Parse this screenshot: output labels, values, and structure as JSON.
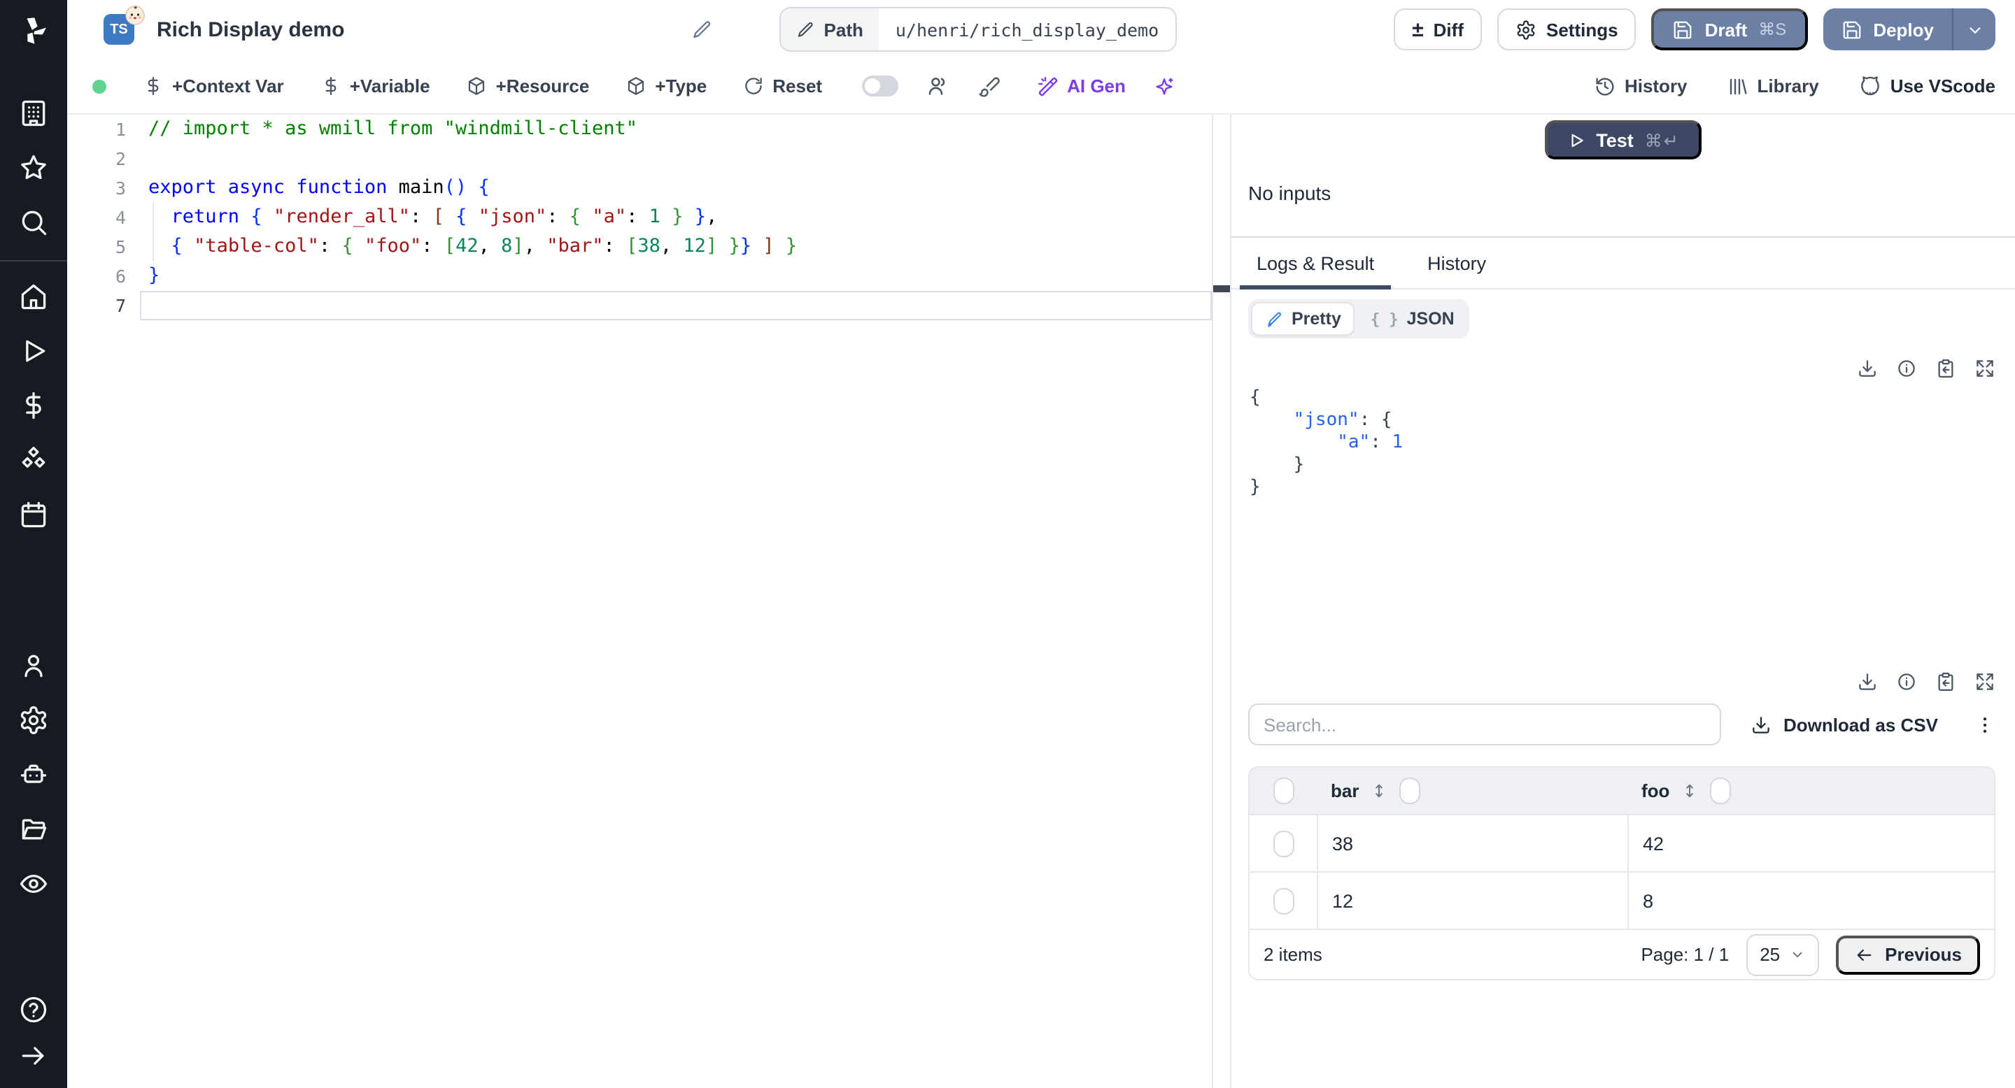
{
  "app": {
    "name": "Windmill"
  },
  "header": {
    "language_badge": "TS",
    "title": "Rich Display demo",
    "path_label": "Path",
    "path_value": "u/henri/rich_display_demo",
    "diff_label": "Diff",
    "settings_label": "Settings",
    "draft_label": "Draft",
    "draft_shortcut": "⌘S",
    "deploy_label": "Deploy"
  },
  "toolbar": {
    "status_dot_color": "#5fd38f",
    "context_var_label": "+Context Var",
    "variable_label": "+Variable",
    "resource_label": "+Resource",
    "type_label": "+Type",
    "reset_label": "Reset",
    "ai_gen_label": "AI Gen",
    "ai_accent_color": "#7c3aed",
    "history_label": "History",
    "library_label": "Library",
    "vscode_label": "Use VScode"
  },
  "sidebar": {
    "items": [
      {
        "icon": "building-icon"
      },
      {
        "icon": "star-icon"
      },
      {
        "icon": "search-icon"
      },
      {
        "icon": "home-icon"
      },
      {
        "icon": "play-icon"
      },
      {
        "icon": "dollar-icon"
      },
      {
        "icon": "cubes-icon"
      },
      {
        "icon": "calendar-icon"
      },
      {
        "icon": "user-icon"
      },
      {
        "icon": "gear-icon"
      },
      {
        "icon": "robot-icon"
      },
      {
        "icon": "folder-icon"
      },
      {
        "icon": "eye-icon"
      },
      {
        "icon": "help-icon"
      },
      {
        "icon": "arrow-right-icon"
      }
    ]
  },
  "editor": {
    "active_line": 7,
    "lines": [
      {
        "n": 1,
        "tokens": [
          [
            "cmt",
            "// import * as wmill from \"windmill-client\""
          ]
        ]
      },
      {
        "n": 2,
        "tokens": []
      },
      {
        "n": 3,
        "tokens": [
          [
            "kw",
            "export async function "
          ],
          [
            "def",
            "main"
          ],
          [
            "b1",
            "()"
          ],
          [
            "def",
            " "
          ],
          [
            "b1",
            "{"
          ]
        ]
      },
      {
        "n": 4,
        "tokens": [
          [
            "def",
            "  "
          ],
          [
            "kw",
            "return"
          ],
          [
            "def",
            " "
          ],
          [
            "b1",
            "{"
          ],
          [
            "def",
            " "
          ],
          [
            "str",
            "\"render_all\""
          ],
          [
            "def",
            ": "
          ],
          [
            "b3",
            "["
          ],
          [
            "def",
            " "
          ],
          [
            "b1",
            "{"
          ],
          [
            "def",
            " "
          ],
          [
            "str",
            "\"json\""
          ],
          [
            "def",
            ": "
          ],
          [
            "b2",
            "{"
          ],
          [
            "def",
            " "
          ],
          [
            "str",
            "\"a\""
          ],
          [
            "def",
            ": "
          ],
          [
            "num",
            "1"
          ],
          [
            "def",
            " "
          ],
          [
            "b2",
            "}"
          ],
          [
            "def",
            " "
          ],
          [
            "b1",
            "}"
          ],
          [
            "def",
            ","
          ]
        ]
      },
      {
        "n": 5,
        "tokens": [
          [
            "def",
            "  "
          ],
          [
            "b1",
            "{"
          ],
          [
            "def",
            " "
          ],
          [
            "str",
            "\"table-col\""
          ],
          [
            "def",
            ": "
          ],
          [
            "b2",
            "{"
          ],
          [
            "def",
            " "
          ],
          [
            "str",
            "\"foo\""
          ],
          [
            "def",
            ": "
          ],
          [
            "b2",
            "["
          ],
          [
            "num",
            "42"
          ],
          [
            "def",
            ", "
          ],
          [
            "num",
            "8"
          ],
          [
            "b2",
            "]"
          ],
          [
            "def",
            ", "
          ],
          [
            "str",
            "\"bar\""
          ],
          [
            "def",
            ": "
          ],
          [
            "b2",
            "["
          ],
          [
            "num",
            "38"
          ],
          [
            "def",
            ", "
          ],
          [
            "num",
            "12"
          ],
          [
            "b2",
            "]"
          ],
          [
            "def",
            " "
          ],
          [
            "b2",
            "}"
          ],
          [
            "b1",
            "}"
          ],
          [
            "def",
            " "
          ],
          [
            "b3",
            "]"
          ],
          [
            "def",
            " "
          ],
          [
            "b2",
            "}"
          ]
        ]
      },
      {
        "n": 6,
        "tokens": [
          [
            "b1",
            "}"
          ]
        ]
      },
      {
        "n": 7,
        "tokens": []
      }
    ]
  },
  "run_panel": {
    "test_label": "Test",
    "test_shortcut": "⌘↵",
    "no_inputs_text": "No inputs",
    "tabs": [
      {
        "label": "Logs & Result"
      },
      {
        "label": "History"
      }
    ],
    "active_tab": "Logs & Result",
    "pretty_label": "Pretty",
    "json_label": "JSON",
    "json_toggle_glyph": "{ }"
  },
  "result": {
    "pretty_json_lines": [
      [
        [
          "p",
          "{"
        ]
      ],
      [
        [
          "p",
          "    "
        ],
        [
          "k",
          "\"json\""
        ],
        [
          "p",
          ": {"
        ]
      ],
      [
        [
          "p",
          "        "
        ],
        [
          "k",
          "\"a\""
        ],
        [
          "p",
          ": "
        ],
        [
          "n",
          "1"
        ]
      ],
      [
        [
          "p",
          "    }"
        ]
      ],
      [
        [
          "p",
          "}"
        ]
      ]
    ],
    "toolbar_icons": [
      "download-icon",
      "info-icon",
      "clipboard-copy-icon",
      "expand-icon"
    ]
  },
  "table": {
    "search_placeholder": "Search...",
    "download_csv_label": "Download as CSV",
    "columns": [
      "bar",
      "foo"
    ],
    "rows": [
      [
        "38",
        "42"
      ],
      [
        "12",
        "8"
      ]
    ],
    "footer": {
      "items_count": "2 items",
      "page_label": "Page: 1 / 1",
      "page_size": "25",
      "previous_label": "Previous"
    }
  },
  "colors": {
    "sidebar_bg": "#171a21",
    "primary_button_bg": "#6b80a4",
    "test_button_bg": "#3d4964",
    "accent_purple": "#7c3aed",
    "status_green": "#5fd38f",
    "json_key_blue": "#2563eb"
  }
}
